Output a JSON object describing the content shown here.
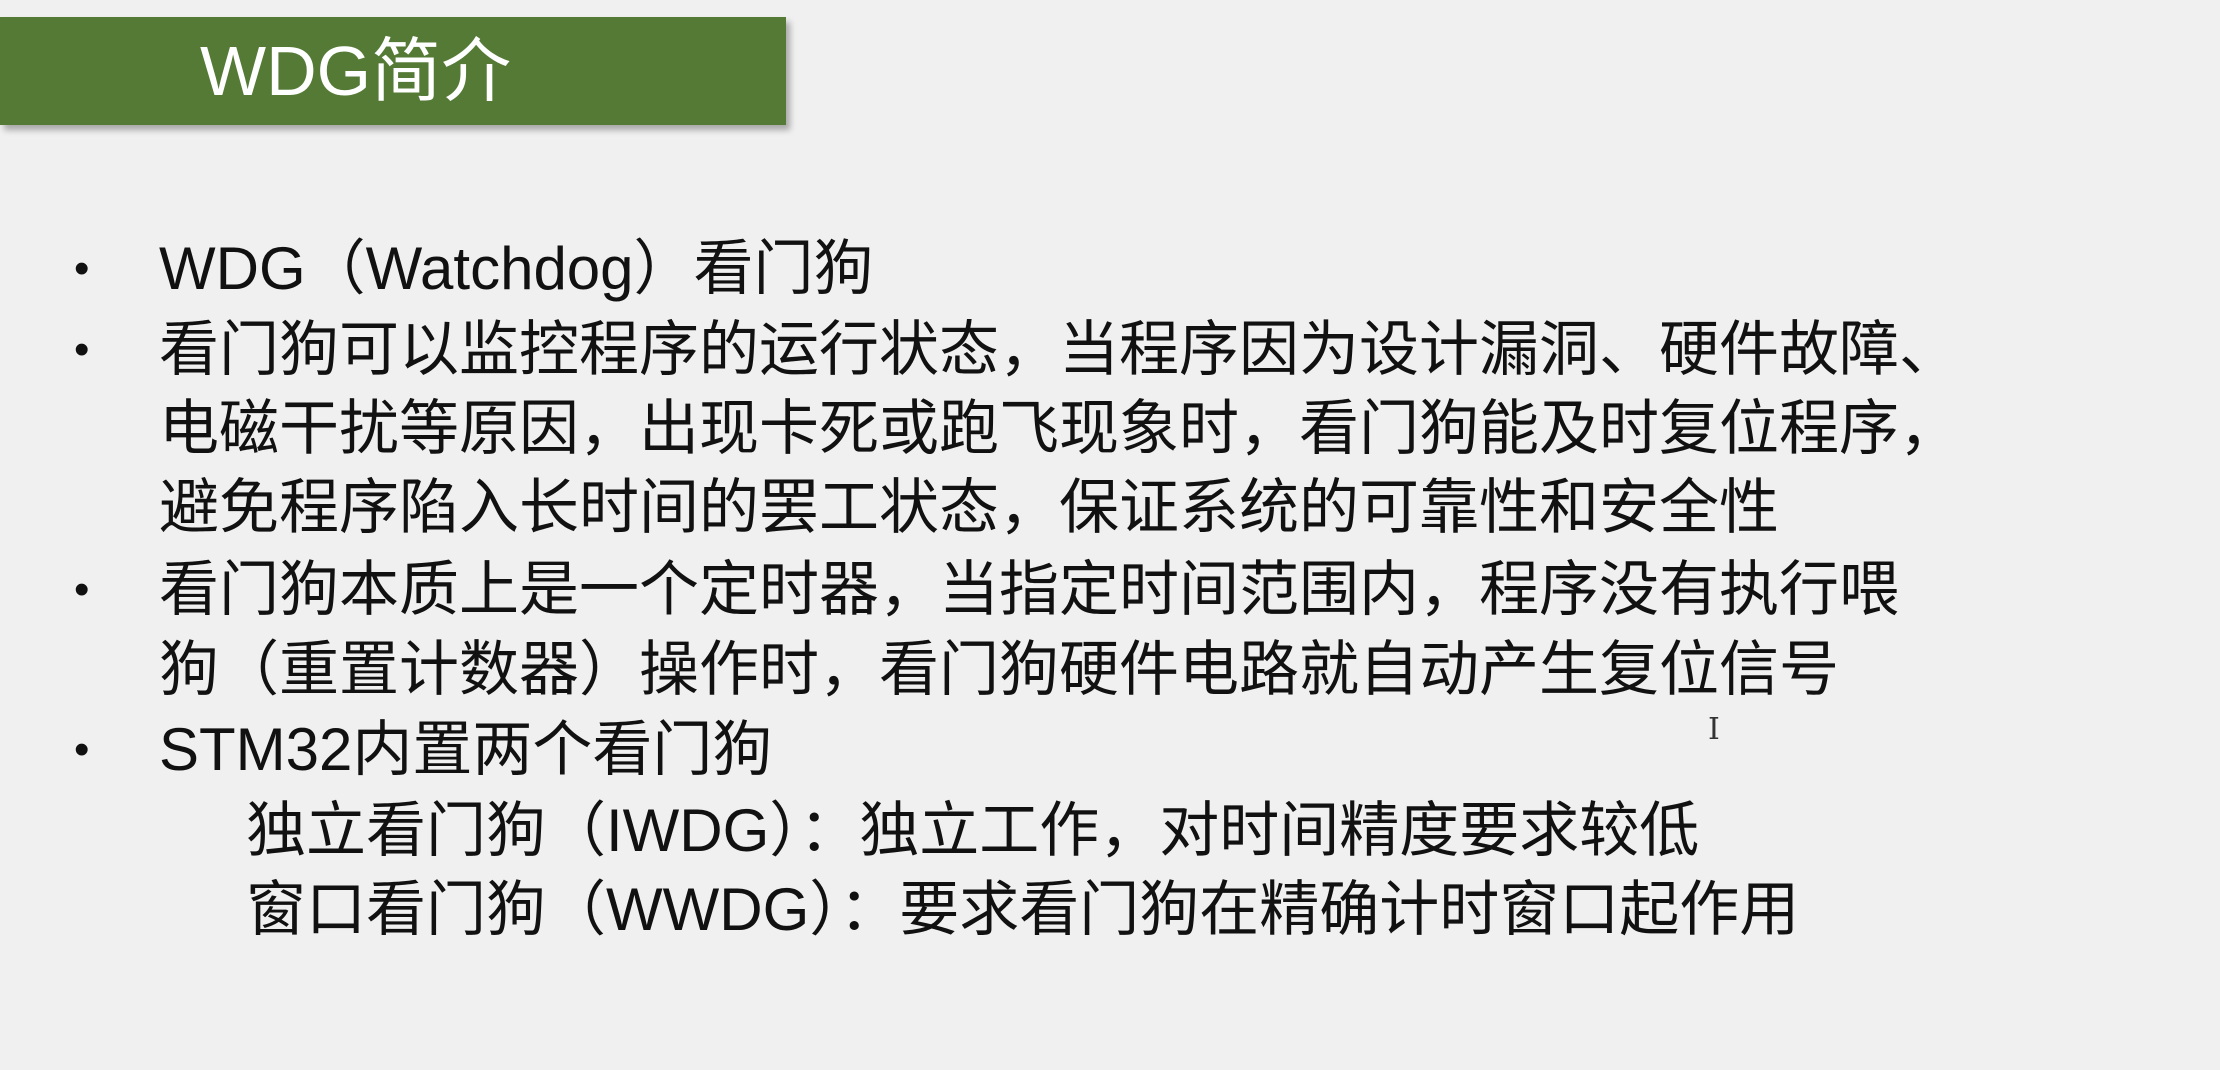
{
  "slide": {
    "title": "WDG简介",
    "bullet_symbol": "•",
    "bullets": [
      {
        "lines": [
          "WDG（Watchdog）看门狗"
        ]
      },
      {
        "lines": [
          "看门狗可以监控程序的运行状态，当程序因为设计漏洞、硬件故障、",
          "电磁干扰等原因，出现卡死或跑飞现象时，看门狗能及时复位程序，",
          "避免程序陷入长时间的罢工状态，保证系统的可靠性和安全性"
        ]
      },
      {
        "lines": [
          "看门狗本质上是一个定时器，当指定时间范围内，程序没有执行喂",
          "狗（重置计数器）操作时，看门狗硬件电路就自动产生复位信号"
        ]
      },
      {
        "lines": [
          "STM32内置两个看门狗"
        ]
      }
    ],
    "sub_items": [
      "独立看门狗（IWDG）：独立工作，对时间精度要求较低",
      "窗口看门狗（WWDG）：要求看门狗在精确计时窗口起作用"
    ],
    "cursor_glyph": "I",
    "colors": {
      "title_bar": "#547a35",
      "background": "#f0f0f0"
    }
  }
}
